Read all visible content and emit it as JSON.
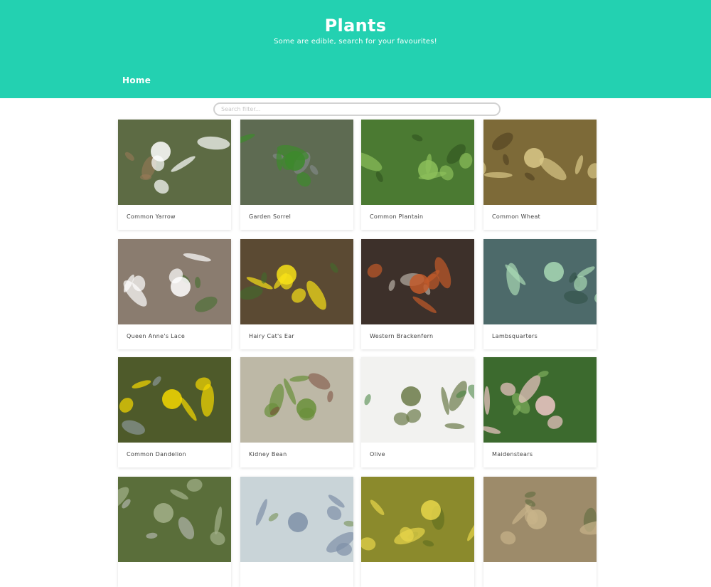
{
  "header": {
    "title": "Plants",
    "subtitle": "Some are edible, search for your favourites!",
    "background": "#23d1b1"
  },
  "nav": {
    "home_label": "Home"
  },
  "search": {
    "placeholder": "Search filter...",
    "value": ""
  },
  "plants": [
    {
      "name": "Common Yarrow",
      "photo": {
        "bg": "#5d6b44",
        "accent": "#ffffff",
        "accent2": "#9c7a5a"
      }
    },
    {
      "name": "Garden Sorrel",
      "photo": {
        "bg": "#5e6b52",
        "accent": "#3d8a2c",
        "accent2": "#8a8f94"
      }
    },
    {
      "name": "Common Plantain",
      "photo": {
        "bg": "#4b7a32",
        "accent": "#8cbf5a",
        "accent2": "#2e4f1d"
      }
    },
    {
      "name": "Common Wheat",
      "photo": {
        "bg": "#7d6a38",
        "accent": "#d9c888",
        "accent2": "#4a3b1d"
      }
    },
    {
      "name": "Queen Anne's Lace",
      "photo": {
        "bg": "#8a7c6f",
        "accent": "#ffffff",
        "accent2": "#3f6d2a"
      }
    },
    {
      "name": "Hairy Cat's Ear",
      "photo": {
        "bg": "#5b4a33",
        "accent": "#f7e017",
        "accent2": "#3e7029"
      }
    },
    {
      "name": "Western Brackenfern",
      "photo": {
        "bg": "#3d302a",
        "accent": "#c25a2a",
        "accent2": "#d8d1c4"
      }
    },
    {
      "name": "Lambsquarters",
      "photo": {
        "bg": "#4d6a6a",
        "accent": "#a8d8b4",
        "accent2": "#2f4f44"
      }
    },
    {
      "name": "Common Dandelion",
      "photo": {
        "bg": "#4e5a2a",
        "accent": "#f5d800",
        "accent2": "#9aa8b4"
      }
    },
    {
      "name": "Kidney Bean",
      "photo": {
        "bg": "#bdb8a6",
        "accent": "#6a8f3a",
        "accent2": "#7a4a3a"
      }
    },
    {
      "name": "Olive",
      "photo": {
        "bg": "#f2f2f0",
        "accent": "#6b7a48",
        "accent2": "#3f7f3a"
      }
    },
    {
      "name": "Maidenstears",
      "photo": {
        "bg": "#3c6a2e",
        "accent": "#f0c8c8",
        "accent2": "#8fbf6a"
      }
    },
    {
      "name": "",
      "photo": {
        "bg": "#5a6e3a",
        "accent": "#a3b08a",
        "accent2": "#c8c8c8"
      }
    },
    {
      "name": "",
      "photo": {
        "bg": "#c9d4d8",
        "accent": "#7f90a8",
        "accent2": "#6f8a4a"
      }
    },
    {
      "name": "",
      "photo": {
        "bg": "#8b8a2c",
        "accent": "#e8d64a",
        "accent2": "#5a6a1e"
      }
    },
    {
      "name": "",
      "photo": {
        "bg": "#9d8b6a",
        "accent": "#c8b48a",
        "accent2": "#5a6a3a"
      }
    }
  ]
}
